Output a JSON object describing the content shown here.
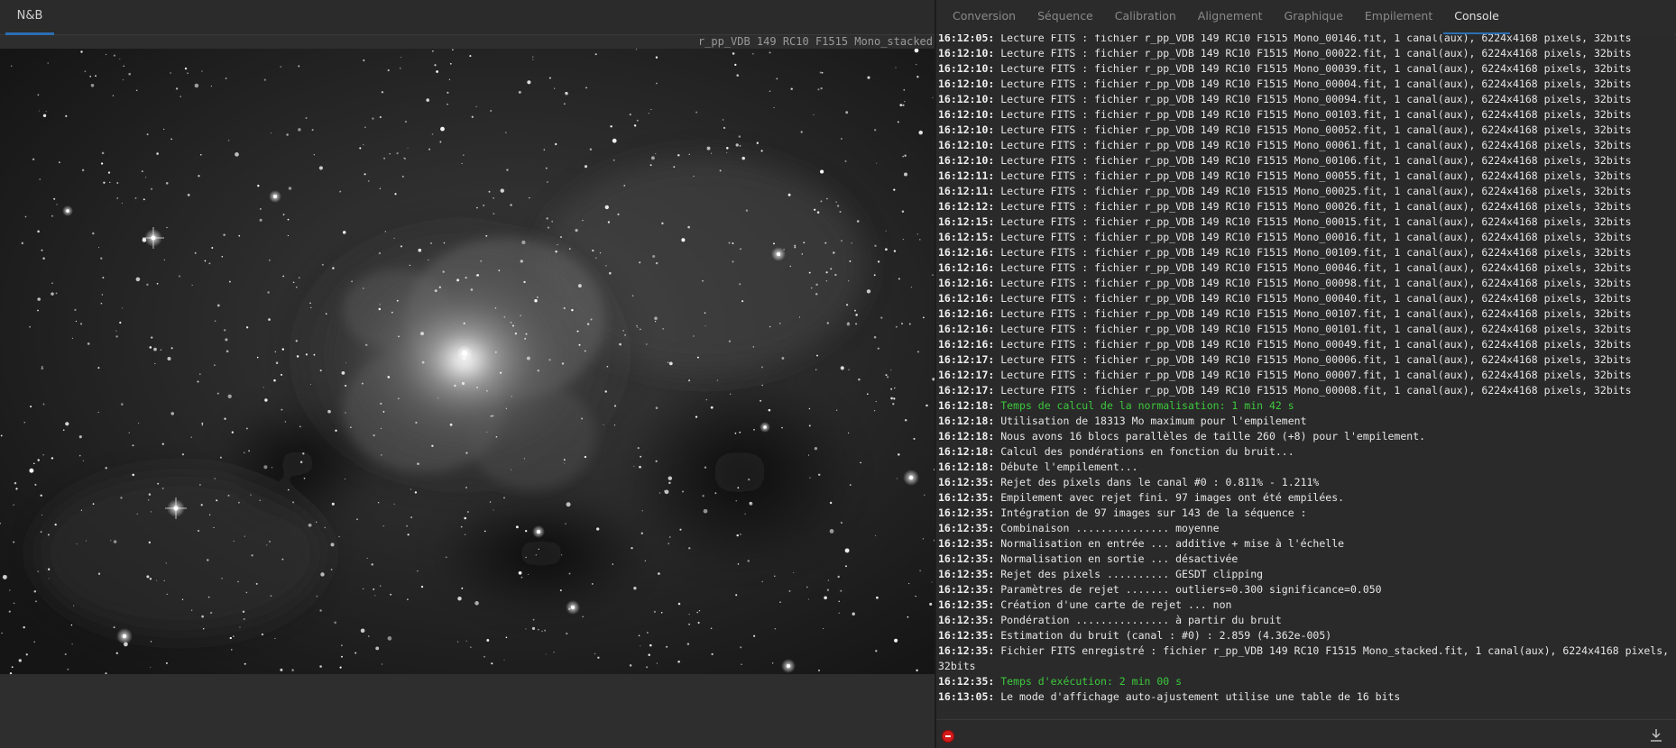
{
  "left_panel": {
    "tab_label": "N&B",
    "filename": "r_pp_VDB 149 RC10 F1515 Mono_stacked",
    "image_description": "monochrome deep-sky image of a reflection nebula with dense starfield"
  },
  "right_panel": {
    "tabs": [
      {
        "label": "Conversion",
        "active": false
      },
      {
        "label": "Séquence",
        "active": false
      },
      {
        "label": "Calibration",
        "active": false
      },
      {
        "label": "Alignement",
        "active": false
      },
      {
        "label": "Graphique",
        "active": false
      },
      {
        "label": "Empilement",
        "active": false
      },
      {
        "label": "Console",
        "active": true
      }
    ],
    "console": [
      {
        "time": "16:12:05:",
        "text": "Lecture FITS : fichier r_pp_VDB 149 RC10 F1515 Mono_00146.fit, 1 canal(aux), 6224x4168 pixels, 32bits",
        "color": "default"
      },
      {
        "time": "16:12:10:",
        "text": "Lecture FITS : fichier r_pp_VDB 149 RC10 F1515 Mono_00022.fit, 1 canal(aux), 6224x4168 pixels, 32bits",
        "color": "default"
      },
      {
        "time": "16:12:10:",
        "text": "Lecture FITS : fichier r_pp_VDB 149 RC10 F1515 Mono_00039.fit, 1 canal(aux), 6224x4168 pixels, 32bits",
        "color": "default"
      },
      {
        "time": "16:12:10:",
        "text": "Lecture FITS : fichier r_pp_VDB 149 RC10 F1515 Mono_00004.fit, 1 canal(aux), 6224x4168 pixels, 32bits",
        "color": "default"
      },
      {
        "time": "16:12:10:",
        "text": "Lecture FITS : fichier r_pp_VDB 149 RC10 F1515 Mono_00094.fit, 1 canal(aux), 6224x4168 pixels, 32bits",
        "color": "default"
      },
      {
        "time": "16:12:10:",
        "text": "Lecture FITS : fichier r_pp_VDB 149 RC10 F1515 Mono_00103.fit, 1 canal(aux), 6224x4168 pixels, 32bits",
        "color": "default"
      },
      {
        "time": "16:12:10:",
        "text": "Lecture FITS : fichier r_pp_VDB 149 RC10 F1515 Mono_00052.fit, 1 canal(aux), 6224x4168 pixels, 32bits",
        "color": "default"
      },
      {
        "time": "16:12:10:",
        "text": "Lecture FITS : fichier r_pp_VDB 149 RC10 F1515 Mono_00061.fit, 1 canal(aux), 6224x4168 pixels, 32bits",
        "color": "default"
      },
      {
        "time": "16:12:10:",
        "text": "Lecture FITS : fichier r_pp_VDB 149 RC10 F1515 Mono_00106.fit, 1 canal(aux), 6224x4168 pixels, 32bits",
        "color": "default"
      },
      {
        "time": "16:12:11:",
        "text": "Lecture FITS : fichier r_pp_VDB 149 RC10 F1515 Mono_00055.fit, 1 canal(aux), 6224x4168 pixels, 32bits",
        "color": "default"
      },
      {
        "time": "16:12:11:",
        "text": "Lecture FITS : fichier r_pp_VDB 149 RC10 F1515 Mono_00025.fit, 1 canal(aux), 6224x4168 pixels, 32bits",
        "color": "default"
      },
      {
        "time": "16:12:12:",
        "text": "Lecture FITS : fichier r_pp_VDB 149 RC10 F1515 Mono_00026.fit, 1 canal(aux), 6224x4168 pixels, 32bits",
        "color": "default"
      },
      {
        "time": "16:12:15:",
        "text": "Lecture FITS : fichier r_pp_VDB 149 RC10 F1515 Mono_00015.fit, 1 canal(aux), 6224x4168 pixels, 32bits",
        "color": "default"
      },
      {
        "time": "16:12:15:",
        "text": "Lecture FITS : fichier r_pp_VDB 149 RC10 F1515 Mono_00016.fit, 1 canal(aux), 6224x4168 pixels, 32bits",
        "color": "default"
      },
      {
        "time": "16:12:16:",
        "text": "Lecture FITS : fichier r_pp_VDB 149 RC10 F1515 Mono_00109.fit, 1 canal(aux), 6224x4168 pixels, 32bits",
        "color": "default"
      },
      {
        "time": "16:12:16:",
        "text": "Lecture FITS : fichier r_pp_VDB 149 RC10 F1515 Mono_00046.fit, 1 canal(aux), 6224x4168 pixels, 32bits",
        "color": "default"
      },
      {
        "time": "16:12:16:",
        "text": "Lecture FITS : fichier r_pp_VDB 149 RC10 F1515 Mono_00098.fit, 1 canal(aux), 6224x4168 pixels, 32bits",
        "color": "default"
      },
      {
        "time": "16:12:16:",
        "text": "Lecture FITS : fichier r_pp_VDB 149 RC10 F1515 Mono_00040.fit, 1 canal(aux), 6224x4168 pixels, 32bits",
        "color": "default"
      },
      {
        "time": "16:12:16:",
        "text": "Lecture FITS : fichier r_pp_VDB 149 RC10 F1515 Mono_00107.fit, 1 canal(aux), 6224x4168 pixels, 32bits",
        "color": "default"
      },
      {
        "time": "16:12:16:",
        "text": "Lecture FITS : fichier r_pp_VDB 149 RC10 F1515 Mono_00101.fit, 1 canal(aux), 6224x4168 pixels, 32bits",
        "color": "default"
      },
      {
        "time": "16:12:16:",
        "text": "Lecture FITS : fichier r_pp_VDB 149 RC10 F1515 Mono_00049.fit, 1 canal(aux), 6224x4168 pixels, 32bits",
        "color": "default"
      },
      {
        "time": "16:12:17:",
        "text": "Lecture FITS : fichier r_pp_VDB 149 RC10 F1515 Mono_00006.fit, 1 canal(aux), 6224x4168 pixels, 32bits",
        "color": "default"
      },
      {
        "time": "16:12:17:",
        "text": "Lecture FITS : fichier r_pp_VDB 149 RC10 F1515 Mono_00007.fit, 1 canal(aux), 6224x4168 pixels, 32bits",
        "color": "default"
      },
      {
        "time": "16:12:17:",
        "text": "Lecture FITS : fichier r_pp_VDB 149 RC10 F1515 Mono_00008.fit, 1 canal(aux), 6224x4168 pixels, 32bits",
        "color": "default"
      },
      {
        "time": "16:12:18:",
        "text": "Temps de calcul de la normalisation: 1 min 42 s",
        "color": "green"
      },
      {
        "time": "16:12:18:",
        "text": "Utilisation de 18313 Mo maximum pour l'empilement",
        "color": "default"
      },
      {
        "time": "16:12:18:",
        "text": "Nous avons 16 blocs parallèles de taille 260 (+8) pour l'empilement.",
        "color": "default"
      },
      {
        "time": "16:12:18:",
        "text": "Calcul des pondérations en fonction du bruit...",
        "color": "default"
      },
      {
        "time": "16:12:18:",
        "text": "Débute l'empilement...",
        "color": "default"
      },
      {
        "time": "16:12:35:",
        "text": "Rejet des pixels dans le canal #0 : 0.811% - 1.211%",
        "color": "default"
      },
      {
        "time": "16:12:35:",
        "text": "Empilement avec rejet fini. 97 images ont été empilées.",
        "color": "default"
      },
      {
        "time": "16:12:35:",
        "text": "Intégration de 97 images sur 143 de la séquence :",
        "color": "default"
      },
      {
        "time": "16:12:35:",
        "text": "Combinaison ............... moyenne",
        "color": "default"
      },
      {
        "time": "16:12:35:",
        "text": "Normalisation en entrée ... additive + mise à l'échelle",
        "color": "default"
      },
      {
        "time": "16:12:35:",
        "text": "Normalisation en sortie ... désactivée",
        "color": "default"
      },
      {
        "time": "16:12:35:",
        "text": "Rejet des pixels .......... GESDT clipping",
        "color": "default"
      },
      {
        "time": "16:12:35:",
        "text": "Paramètres de rejet ....... outliers=0.300 significance=0.050",
        "color": "default"
      },
      {
        "time": "16:12:35:",
        "text": "Création d'une carte de rejet ... non",
        "color": "default"
      },
      {
        "time": "16:12:35:",
        "text": "Pondération ............... à partir du bruit",
        "color": "default"
      },
      {
        "time": "16:12:35:",
        "text": "Estimation du bruit (canal : #0) : 2.859 (4.362e-005)",
        "color": "default"
      },
      {
        "time": "16:12:35:",
        "text": "Fichier FITS enregistré : fichier r_pp_VDB 149 RC10 F1515 Mono_stacked.fit, 1 canal(aux), 6224x4168 pixels, 32bits",
        "color": "default"
      },
      {
        "time": "16:12:35:",
        "text": "Temps d'exécution: 2 min 00 s",
        "color": "green"
      },
      {
        "time": "16:13:05:",
        "text": "Le mode d'affichage auto-ajustement utilise une table de 16 bits",
        "color": "default"
      }
    ],
    "footer": {
      "stop_icon": "stop-icon",
      "save_icon": "download-icon"
    }
  },
  "colors": {
    "accent": "#2c6fb3",
    "console_green": "#3cc83c",
    "stop_red": "#d41a1a"
  }
}
